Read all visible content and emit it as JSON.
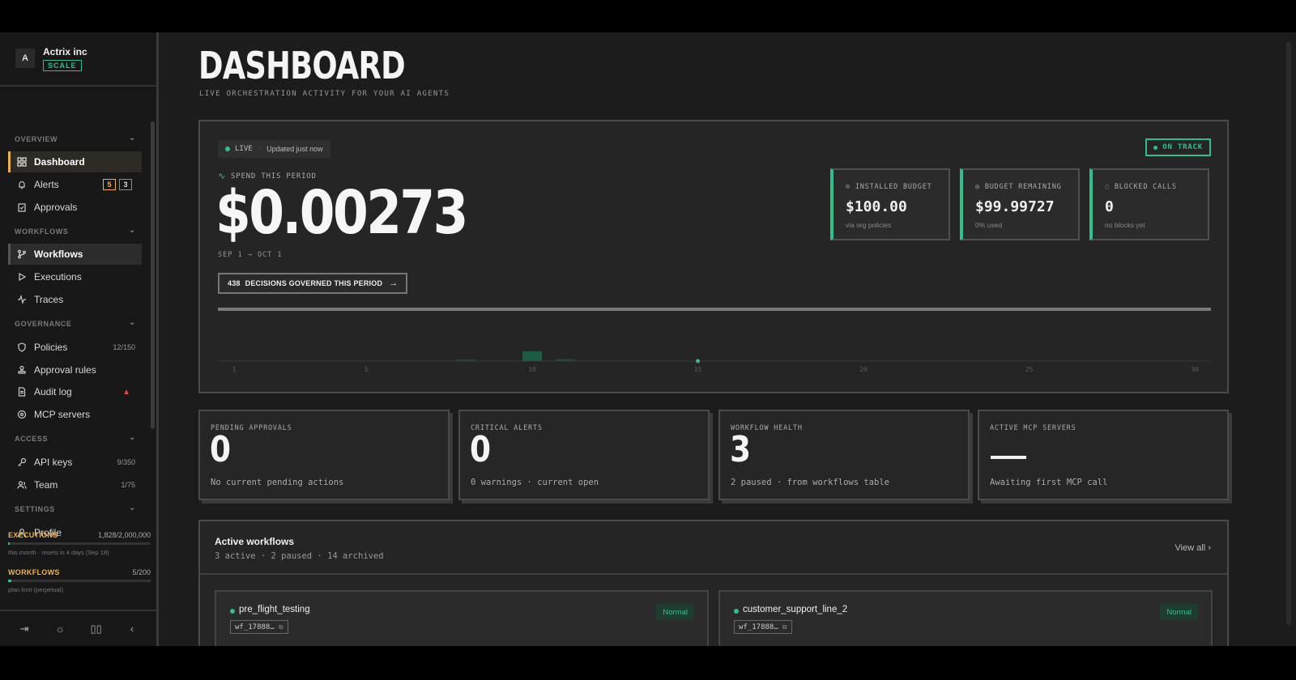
{
  "org": {
    "initial": "A",
    "name": "Actrix inc",
    "plan": "SCALE"
  },
  "sidebar": {
    "sections": {
      "overview": "OVERVIEW",
      "workflows": "WORKFLOWS",
      "governance": "GOVERNANCE",
      "access": "ACCESS",
      "settings": "SETTINGS"
    },
    "items": {
      "dashboard": "Dashboard",
      "alerts": "Alerts",
      "alerts_badge_warn": "5",
      "alerts_badge_info": "3",
      "approvals": "Approvals",
      "workflows": "Workflows",
      "executions": "Executions",
      "traces": "Traces",
      "policies": "Policies",
      "policies_count": "12/150",
      "approval_rules": "Approval rules",
      "audit_log": "Audit log",
      "mcp_servers": "MCP servers",
      "api_keys": "API keys",
      "api_keys_count": "9/350",
      "team": "Team",
      "team_count": "1/75",
      "profile": "Profile"
    },
    "usage": {
      "executions_label": "EXECUTIONS",
      "executions_value": "1,828/2,000,000",
      "executions_fraction": 0.001,
      "executions_sub": "this month · resets in 4 days (Sep 18)",
      "workflows_label": "WORKFLOWS",
      "workflows_value": "5/200",
      "workflows_fraction": 0.025,
      "workflows_sub": "plan limit (perpetual)"
    }
  },
  "page": {
    "title": "DASHBOARD",
    "subtitle": "LIVE ORCHESTRATION ACTIVITY FOR YOUR AI AGENTS"
  },
  "hero": {
    "live_label": "LIVE",
    "updated": "Updated just now",
    "spend_label": "SPEND THIS PERIOD",
    "spend_value": "$0.00273",
    "period": "SEP 1 → OCT 1",
    "decisions_count": "438",
    "decisions_label": "DECISIONS GOVERNED THIS PERIOD",
    "status": "ON TRACK",
    "kpis": [
      {
        "label": "INSTALLED BUDGET",
        "value": "$100.00",
        "sub": "via org policies",
        "icon": "wallet-icon"
      },
      {
        "label": "BUDGET REMAINING",
        "value": "$99.99727",
        "sub": "0% used",
        "icon": "coin-icon"
      },
      {
        "label": "BLOCKED CALLS",
        "value": "0",
        "sub": "no blocks yet",
        "icon": "shield-icon"
      }
    ]
  },
  "chart_data": {
    "type": "bar",
    "x": [
      8,
      10,
      11
    ],
    "values": [
      0.1,
      1.0,
      0.2
    ],
    "point_x": 15,
    "x_ticks": [
      "1",
      "5",
      "10",
      "15",
      "20",
      "25",
      "30"
    ],
    "x_range": [
      1,
      30
    ],
    "accent": "#2fc08a"
  },
  "stats": [
    {
      "label": "PENDING APPROVALS",
      "value": "0",
      "sub": "No current pending actions"
    },
    {
      "label": "CRITICAL ALERTS",
      "value": "0",
      "sub": "0 warnings · current open"
    },
    {
      "label": "WORKFLOW HEALTH",
      "value": "3",
      "sub": "2 paused · from workflows table"
    },
    {
      "label": "ACTIVE MCP SERVERS",
      "value": "",
      "sub": "Awaiting first MCP call"
    }
  ],
  "workflows": {
    "title": "Active workflows",
    "summary": "3 active · 2 paused · 14 archived",
    "view_all": "View all",
    "cards": [
      {
        "name": "pre_flight_testing",
        "id": "wf_17888…",
        "tag": "Normal"
      },
      {
        "name": "customer_support_line_2",
        "id": "wf_17888…",
        "tag": "Normal"
      }
    ]
  },
  "colors": {
    "accent": "#2fc08a",
    "warning": "#f0b14c",
    "danger": "#e04848"
  }
}
